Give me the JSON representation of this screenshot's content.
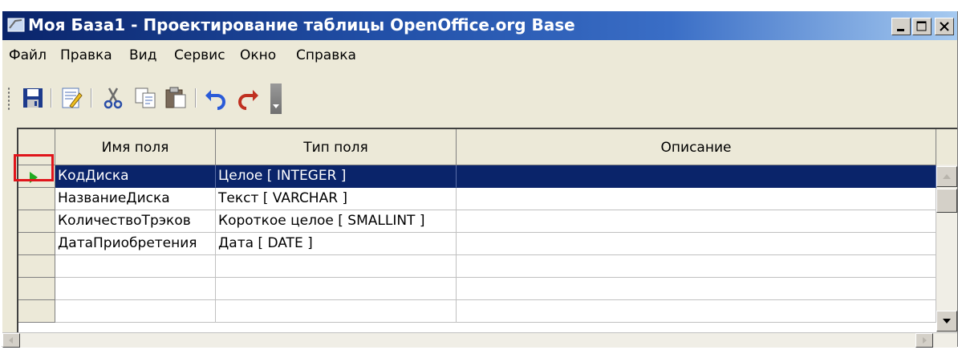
{
  "window": {
    "title": "Моя База1 - Проектирование таблицы OpenOffice.org Base"
  },
  "menu": {
    "items": [
      {
        "label": "Файл"
      },
      {
        "label": "Правка"
      },
      {
        "label": "Вид"
      },
      {
        "label": "Сервис"
      },
      {
        "label": "Окно"
      },
      {
        "label": "Справка"
      }
    ]
  },
  "toolbar": {
    "buttons": [
      "save-icon",
      "edit-mode-icon",
      "cut-icon",
      "copy-icon",
      "paste-icon",
      "undo-icon",
      "redo-icon"
    ]
  },
  "grid": {
    "columns": [
      "Имя поля",
      "Тип поля",
      "Описание"
    ],
    "rows": [
      {
        "name": "КодДиска",
        "type": "Целое [ INTEGER ]",
        "description": ""
      },
      {
        "name": "НазваниеДиска",
        "type": "Текст [ VARCHAR ]",
        "description": ""
      },
      {
        "name": "КоличествоТрэков",
        "type": "Короткое целое [ SMALLINT ]",
        "description": ""
      },
      {
        "name": "ДатаПриобретения",
        "type": "Дата [ DATE ]",
        "description": ""
      },
      {
        "name": "",
        "type": "",
        "description": ""
      },
      {
        "name": "",
        "type": "",
        "description": ""
      },
      {
        "name": "",
        "type": "",
        "description": ""
      }
    ],
    "selected_row": 0
  },
  "colors": {
    "title_bar": "#0a246a",
    "selection": "#0a246a",
    "window_face": "#ece9d8",
    "highlight_border": "#e0151b",
    "row_pointer": "#22aa22"
  }
}
